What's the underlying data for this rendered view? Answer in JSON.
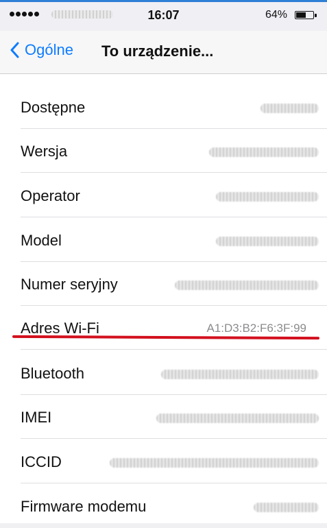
{
  "status_bar": {
    "time": "16:07",
    "battery_percent": "64%",
    "battery_level": 0.64
  },
  "nav": {
    "back_label": "Ogólne",
    "title": "To urządzenie..."
  },
  "rows": [
    {
      "label": "Dostępne"
    },
    {
      "label": "Wersja"
    },
    {
      "label": "Operator"
    },
    {
      "label": "Model"
    },
    {
      "label": "Numer seryjny"
    },
    {
      "label": "Adres Wi-Fi",
      "value": "A1:D3:B2:F6:3F:99"
    },
    {
      "label": "Bluetooth"
    },
    {
      "label": "IMEI"
    },
    {
      "label": "ICCID"
    },
    {
      "label": "Firmware modemu"
    }
  ],
  "colors": {
    "accent": "#0d7cff",
    "highlight": "#d3101e"
  }
}
